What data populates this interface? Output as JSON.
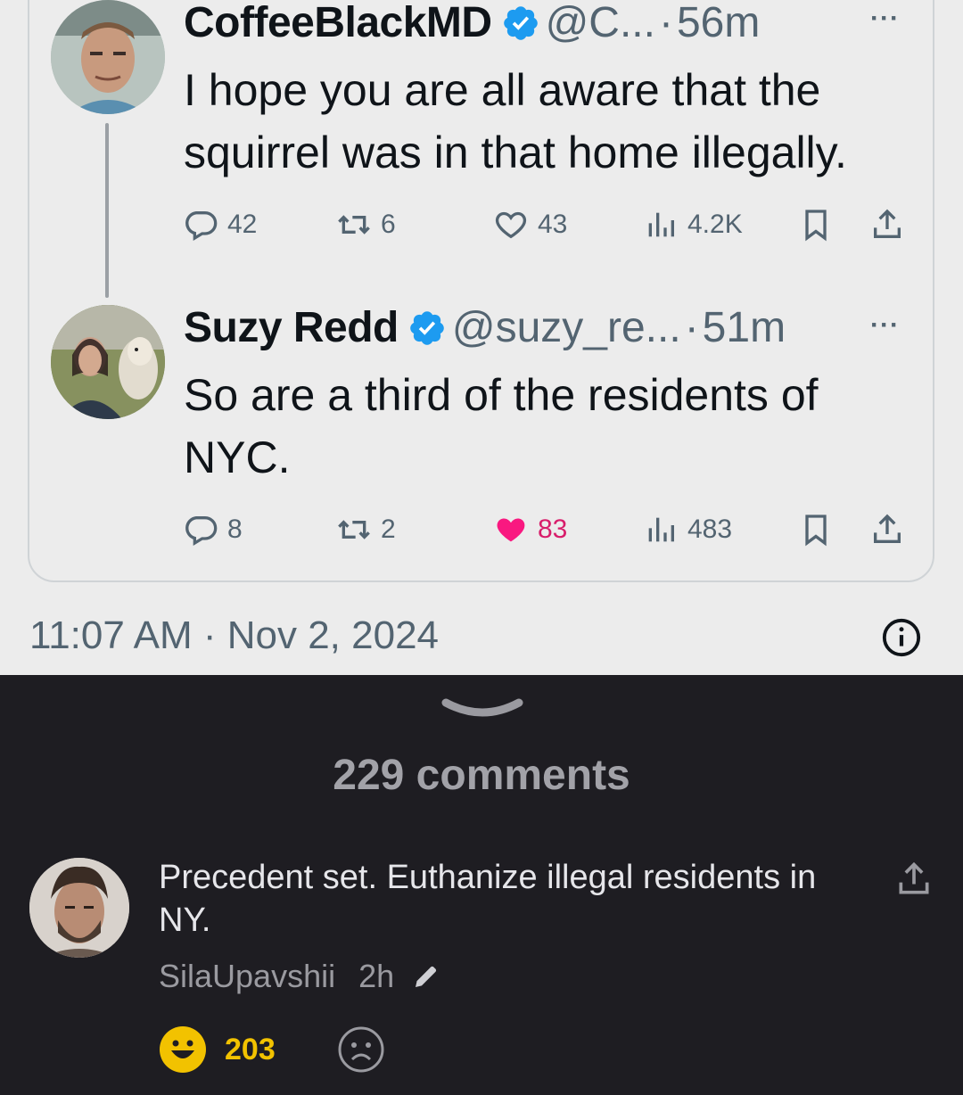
{
  "tweets": [
    {
      "name": "CoffeeBlackMD",
      "handle": "@C...",
      "time": "56m",
      "text_line1": "I hope you are all aware that the",
      "text_line2": "squirrel was in that home illegally.",
      "replies": "42",
      "retweets": "6",
      "likes": "43",
      "views": "4.2K"
    },
    {
      "name": "Suzy Redd",
      "handle": "@suzy_re...",
      "time": "51m",
      "text_line1": "So are a third of the residents of",
      "text_line2": "NYC.",
      "replies": "8",
      "retweets": "2",
      "likes": "83",
      "views": "483",
      "liked": true
    }
  ],
  "timestamp": "11:07 AM · Nov 2, 2024",
  "comments_header": "229 comments",
  "comment": {
    "text": "Precedent set. Euthanize illegal residents in NY.",
    "author": "SilaUpavshii",
    "age": "2h",
    "happy_count": "203"
  },
  "colors": {
    "verified": "#1d9bf0",
    "like": "#f91880",
    "happy": "#f2c200",
    "dark_bg": "#1e1d22"
  },
  "icons": [
    "verified-badge-icon",
    "more-icon",
    "reply-icon",
    "retweet-icon",
    "heart-icon",
    "views-icon",
    "bookmark-icon",
    "share-icon",
    "info-icon",
    "chevron-down-icon",
    "pencil-icon",
    "happy-face-icon",
    "sad-face-icon"
  ]
}
